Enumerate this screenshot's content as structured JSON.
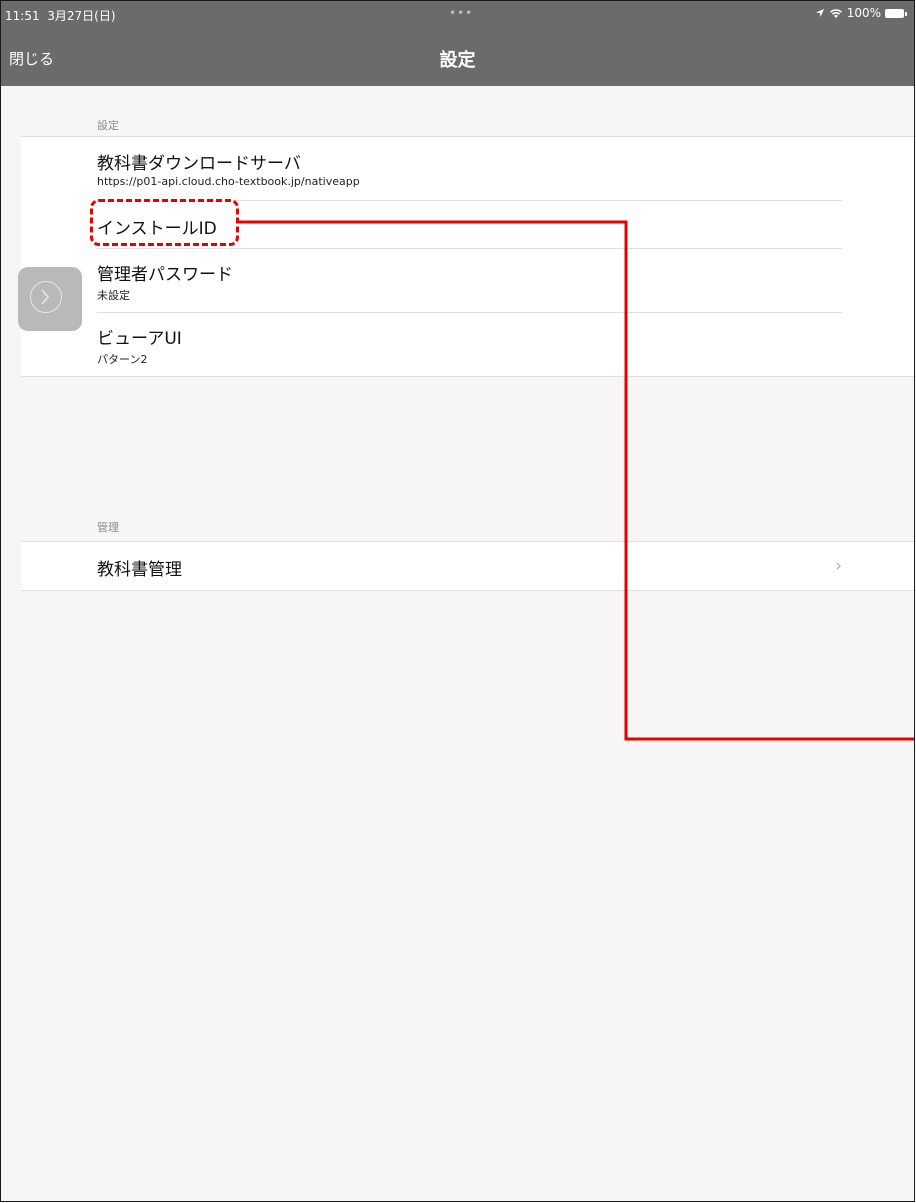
{
  "status_bar": {
    "time": "11:51",
    "date": "3月27日(日)",
    "multitask_dots": "•••",
    "location_icon": "location-arrow-icon",
    "wifi_icon": "wifi-icon",
    "battery_percent": "100%",
    "battery_icon": "battery-full-icon"
  },
  "nav": {
    "close_label": "閉じる",
    "title": "設定"
  },
  "sections": [
    {
      "header": "設定",
      "rows": [
        {
          "label": "教科書ダウンロードサーバ",
          "detail": "https://p01-api.cloud.cho-textbook.jp/nativeapp"
        },
        {
          "label": "インストールID",
          "detail": ""
        },
        {
          "label": "管理者パスワード",
          "detail": "未設定"
        },
        {
          "label": "ビューアUI",
          "detail": "パターン2"
        }
      ]
    },
    {
      "header": "管理",
      "rows": [
        {
          "label": "教科書管理",
          "detail": "",
          "accessory": "chevron-right-icon"
        }
      ]
    }
  ],
  "side_handle_icon": "chevron-right-circle-icon",
  "annotation": {
    "highlight_color": "#e80000",
    "target": "インストールID"
  },
  "colors": {
    "nav_background": "#6d6b69",
    "page_background": "#f8f6f4"
  }
}
